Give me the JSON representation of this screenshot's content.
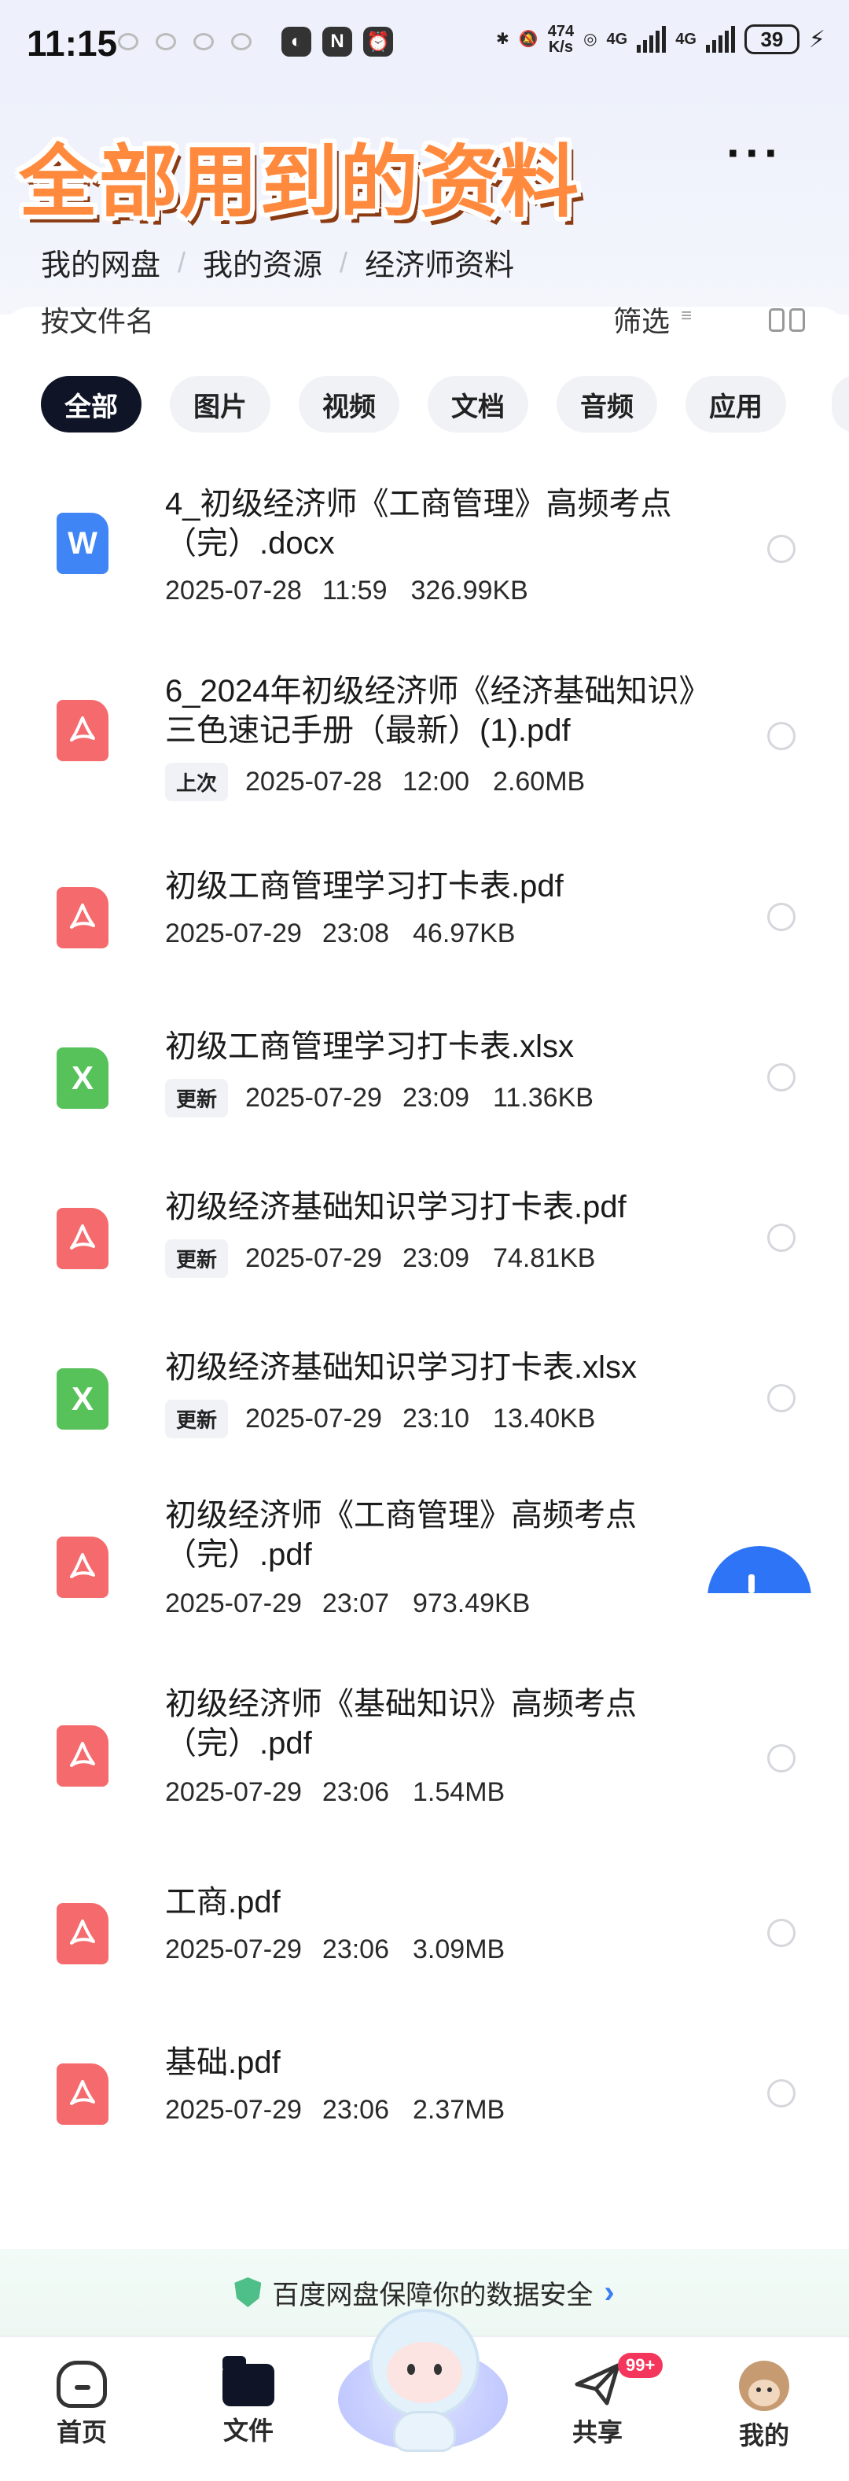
{
  "status_bar": {
    "time": "11:15",
    "net_speed": "474",
    "net_unit": "K/s",
    "net_type_1": "4G",
    "net_type_2": "4G",
    "battery": "39"
  },
  "header": {
    "title": "全部用到的资料",
    "breadcrumb": [
      "我的网盘",
      "我的资源",
      "经济师资料"
    ]
  },
  "sort_bar": {
    "sort_label": "按文件名",
    "filter_label": "筛选"
  },
  "tabs": [
    {
      "label": "全部",
      "active": true
    },
    {
      "label": "图片",
      "active": false
    },
    {
      "label": "视频",
      "active": false
    },
    {
      "label": "文档",
      "active": false
    },
    {
      "label": "音频",
      "active": false
    },
    {
      "label": "应用",
      "active": false
    }
  ],
  "files": [
    {
      "type": "doc",
      "icon_char": "W",
      "name": "4_初级经济师《工商管理》高频考点（完）.docx",
      "badge": "",
      "date": "2025-07-28",
      "time": "11:59",
      "size": "326.99KB"
    },
    {
      "type": "pdf",
      "icon_char": "",
      "name": "6_2024年初级经济师《经济基础知识》三色速记手册（最新）(1).pdf",
      "badge": "上次",
      "date": "2025-07-28",
      "time": "12:00",
      "size": "2.60MB"
    },
    {
      "type": "pdf",
      "icon_char": "",
      "name": "初级工商管理学习打卡表.pdf",
      "badge": "",
      "date": "2025-07-29",
      "time": "23:08",
      "size": "46.97KB"
    },
    {
      "type": "xls",
      "icon_char": "X",
      "name": "初级工商管理学习打卡表.xlsx",
      "badge": "更新",
      "date": "2025-07-29",
      "time": "23:09",
      "size": "11.36KB"
    },
    {
      "type": "pdf",
      "icon_char": "",
      "name": "初级经济基础知识学习打卡表.pdf",
      "badge": "更新",
      "date": "2025-07-29",
      "time": "23:09",
      "size": "74.81KB"
    },
    {
      "type": "xls",
      "icon_char": "X",
      "name": "初级经济基础知识学习打卡表.xlsx",
      "badge": "更新",
      "date": "2025-07-29",
      "time": "23:10",
      "size": "13.40KB"
    },
    {
      "type": "pdf",
      "icon_char": "",
      "name": "初级经济师《工商管理》高频考点（完）.pdf",
      "badge": "",
      "date": "2025-07-29",
      "time": "23:07",
      "size": "973.49KB"
    },
    {
      "type": "pdf",
      "icon_char": "",
      "name": "初级经济师《基础知识》高频考点（完）.pdf",
      "badge": "",
      "date": "2025-07-29",
      "time": "23:06",
      "size": "1.54MB"
    },
    {
      "type": "pdf",
      "icon_char": "",
      "name": "工商.pdf",
      "badge": "",
      "date": "2025-07-29",
      "time": "23:06",
      "size": "3.09MB"
    },
    {
      "type": "pdf",
      "icon_char": "",
      "name": "基础.pdf",
      "badge": "",
      "date": "2025-07-29",
      "time": "23:06",
      "size": "2.37MB"
    }
  ],
  "security_banner": {
    "text": "百度网盘保障你的数据安全",
    "arrow": "›"
  },
  "bottom_nav": {
    "home": "首页",
    "files": "文件",
    "share": "共享",
    "share_badge": "99+",
    "mine": "我的"
  },
  "colors": {
    "title_orange": "#ff8a3d",
    "pdf_red": "#f56a6d",
    "doc_blue": "#3f85f5",
    "xls_green": "#57c15a",
    "fab_blue": "#2e74f6",
    "active_tab": "#0f1526",
    "badge_red": "#f5365c"
  },
  "icons": {
    "more": "more-horizontal-icon",
    "filter": "filter-icon",
    "view": "grid-view-icon",
    "pdf": "pdf-file-icon",
    "doc": "word-file-icon",
    "xls": "excel-file-icon",
    "fab": "plus-icon",
    "shield": "shield-icon"
  }
}
